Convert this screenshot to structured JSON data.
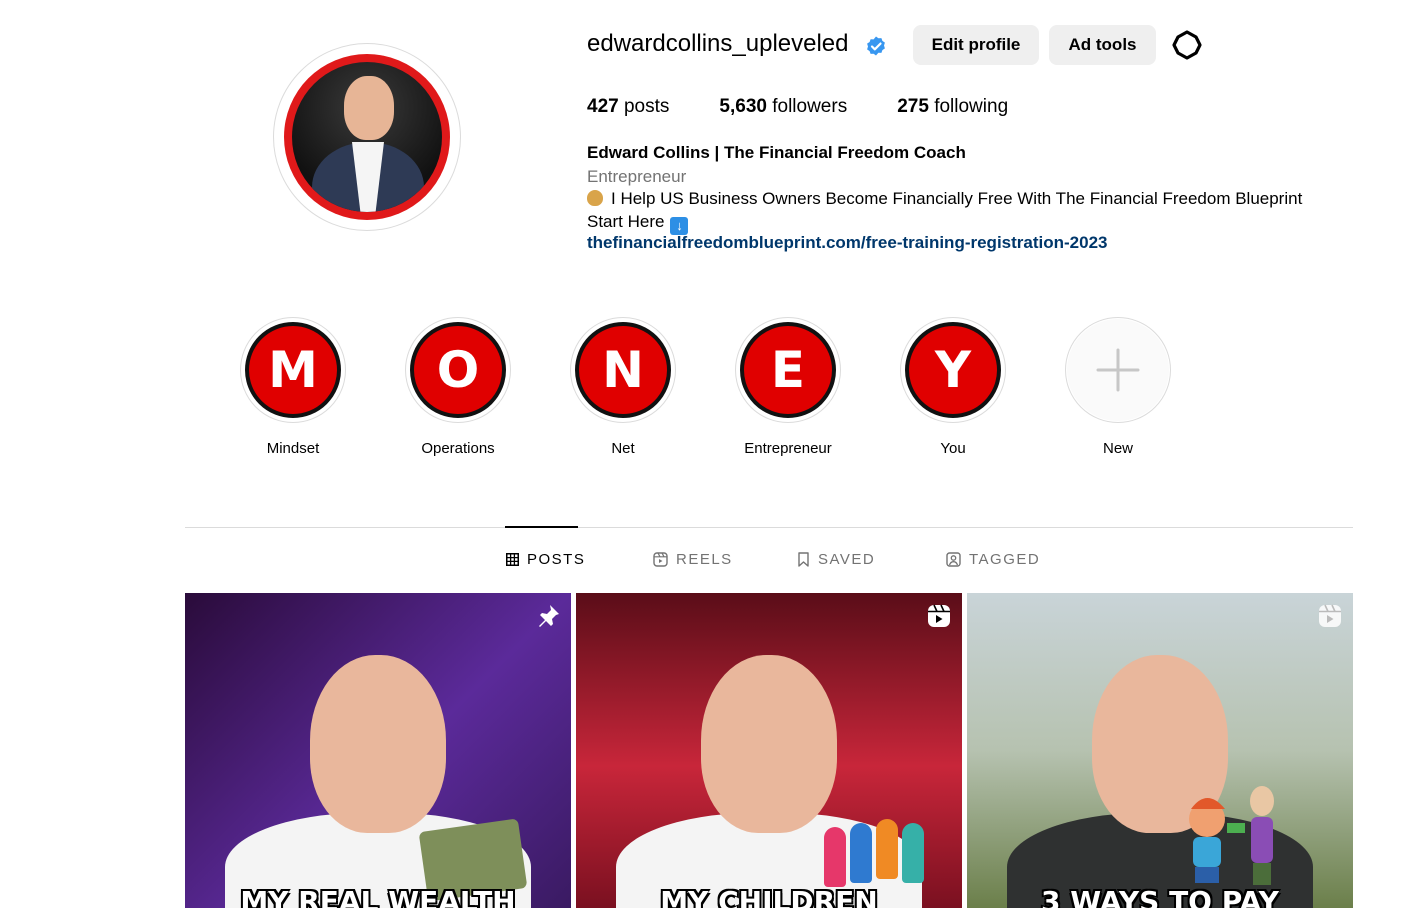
{
  "profile": {
    "username": "edwardcollins_upleveled",
    "edit_profile_label": "Edit profile",
    "ad_tools_label": "Ad tools"
  },
  "stats": {
    "posts_count": "427",
    "posts_label": "posts",
    "followers_count": "5,630",
    "followers_label": "followers",
    "following_count": "275",
    "following_label": "following"
  },
  "bio": {
    "name": "Edward Collins | The Financial Freedom Coach",
    "category": "Entrepreneur",
    "line1": "I Help US Business Owners Become Financially Free With The Financial Freedom Blueprint",
    "line2": "Start Here",
    "link": "thefinancialfreedomblueprint.com/free-training-registration-2023"
  },
  "highlights": [
    {
      "letter": "M",
      "label": "Mindset"
    },
    {
      "letter": "O",
      "label": "Operations"
    },
    {
      "letter": "N",
      "label": "Net"
    },
    {
      "letter": "E",
      "label": "Entrepreneur"
    },
    {
      "letter": "Y",
      "label": "You"
    },
    {
      "letter": "",
      "label": "New"
    }
  ],
  "tabs": {
    "posts": "POSTS",
    "reels": "REELS",
    "saved": "SAVED",
    "tagged": "TAGGED"
  },
  "posts": [
    {
      "caption": "MY REAL WEALTH",
      "icon": "pin-icon"
    },
    {
      "caption": "MY CHILDREN",
      "icon": "reel-icon"
    },
    {
      "caption": "3 WAYS TO PAY",
      "icon": "reel-icon"
    }
  ],
  "colors": {
    "highlight_red": "#e00000",
    "link_blue": "#00376b",
    "verified_blue": "#0095f6",
    "button_bg": "#efefef"
  }
}
